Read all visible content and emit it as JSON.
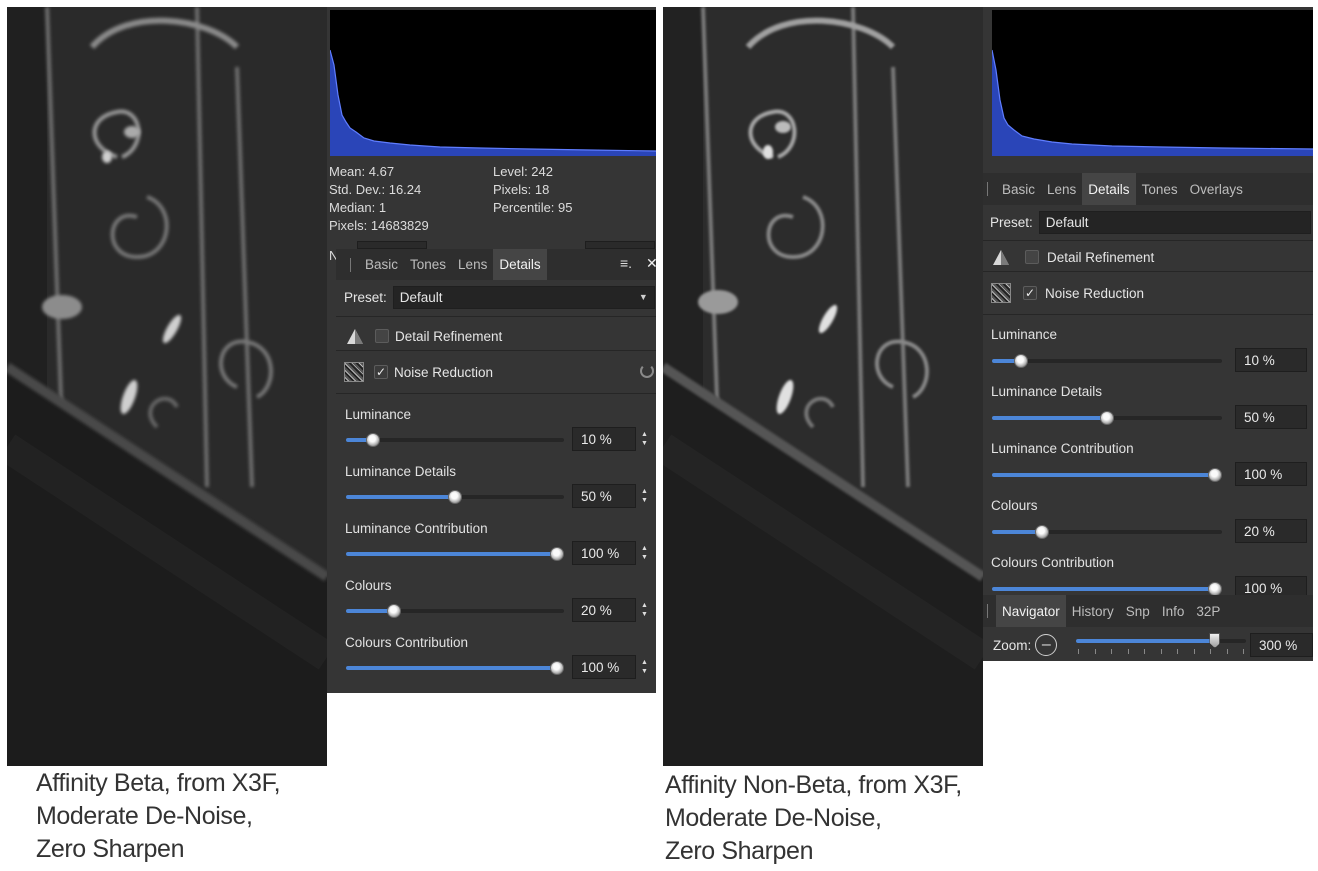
{
  "captions": {
    "left": [
      "Affinity Beta, from X3F,",
      "Moderate De-Noise,",
      "Zero Sharpen"
    ],
    "right": [
      "Affinity Non-Beta, from X3F,",
      "Moderate De-Noise,",
      "Zero Sharpen"
    ]
  },
  "left_panel": {
    "stats": {
      "mean": "Mean: 4.67",
      "std_dev": "Std. Dev.: 16.24",
      "median": "Median: 1",
      "pixels": "Pixels: 14683829",
      "level": "Level: 242",
      "pixels_right": "Pixels: 18",
      "percentile": "Percentile: 95"
    },
    "truncated_label": "N",
    "tabs": [
      "Basic",
      "Tones",
      "Lens",
      "Details"
    ],
    "active_tab": "Details",
    "preset_label": "Preset:",
    "preset_value": "Default",
    "detail_refinement": {
      "label": "Detail Refinement",
      "checked": false
    },
    "noise_reduction": {
      "label": "Noise Reduction",
      "checked": true
    },
    "sliders": [
      {
        "label": "Luminance",
        "value": 10,
        "display": "10 %"
      },
      {
        "label": "Luminance Details",
        "value": 50,
        "display": "50 %"
      },
      {
        "label": "Luminance Contribution",
        "value": 100,
        "display": "100 %"
      },
      {
        "label": "Colours",
        "value": 20,
        "display": "20 %"
      },
      {
        "label": "Colours Contribution",
        "value": 100,
        "display": "100 %"
      }
    ]
  },
  "right_panel": {
    "tabs": [
      "Basic",
      "Lens",
      "Details",
      "Tones",
      "Overlays"
    ],
    "active_tab": "Details",
    "preset_label": "Preset:",
    "preset_value": "Default",
    "detail_refinement": {
      "label": "Detail Refinement",
      "checked": false
    },
    "noise_reduction": {
      "label": "Noise Reduction",
      "checked": true
    },
    "sliders": [
      {
        "label": "Luminance",
        "value": 10,
        "display": "10 %"
      },
      {
        "label": "Luminance Details",
        "value": 50,
        "display": "50 %"
      },
      {
        "label": "Luminance Contribution",
        "value": 100,
        "display": "100 %"
      },
      {
        "label": "Colours",
        "value": 20,
        "display": "20 %"
      },
      {
        "label": "Colours Contribution",
        "value": 100,
        "display": "100 %"
      }
    ],
    "bottom_tabs": [
      "Navigator",
      "History",
      "Snp",
      "Info",
      "32P"
    ],
    "active_bottom_tab": "Navigator",
    "zoom_label": "Zoom:",
    "zoom_value": "300 %",
    "zoom_level_fraction": 0.82
  },
  "colors": {
    "panel_bg": "#353535",
    "accent_blue": "#4c86d8",
    "histogram_blue": "#2a45b8"
  }
}
